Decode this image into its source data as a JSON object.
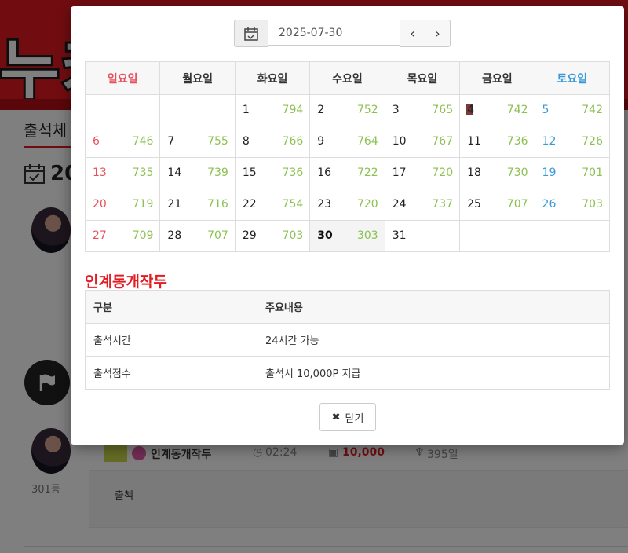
{
  "background": {
    "banner_text": "누키",
    "section_title": "출석체",
    "date_partial": "20",
    "rank": "301등",
    "row": {
      "name": "인계동개작두",
      "time": "02:24",
      "points": "10,000",
      "days": "395일"
    },
    "comment": "출첵"
  },
  "modal": {
    "date_value": "2025-07-30",
    "prev_label": "‹",
    "next_label": "›",
    "weekdays": [
      "일요일",
      "월요일",
      "화요일",
      "수요일",
      "목요일",
      "금요일",
      "토요일"
    ],
    "weeks": [
      [
        {
          "d": "",
          "c": ""
        },
        {
          "d": "",
          "c": ""
        },
        {
          "d": "1",
          "c": "794"
        },
        {
          "d": "2",
          "c": "752"
        },
        {
          "d": "3",
          "c": "765"
        },
        {
          "d": "4",
          "c": "742"
        },
        {
          "d": "5",
          "c": "742"
        }
      ],
      [
        {
          "d": "6",
          "c": "746"
        },
        {
          "d": "7",
          "c": "755"
        },
        {
          "d": "8",
          "c": "766"
        },
        {
          "d": "9",
          "c": "764"
        },
        {
          "d": "10",
          "c": "767"
        },
        {
          "d": "11",
          "c": "736"
        },
        {
          "d": "12",
          "c": "726"
        }
      ],
      [
        {
          "d": "13",
          "c": "735"
        },
        {
          "d": "14",
          "c": "739"
        },
        {
          "d": "15",
          "c": "736"
        },
        {
          "d": "16",
          "c": "722"
        },
        {
          "d": "17",
          "c": "720"
        },
        {
          "d": "18",
          "c": "730"
        },
        {
          "d": "19",
          "c": "701"
        }
      ],
      [
        {
          "d": "20",
          "c": "719"
        },
        {
          "d": "21",
          "c": "716"
        },
        {
          "d": "22",
          "c": "754"
        },
        {
          "d": "23",
          "c": "720"
        },
        {
          "d": "24",
          "c": "737"
        },
        {
          "d": "25",
          "c": "707"
        },
        {
          "d": "26",
          "c": "703"
        }
      ],
      [
        {
          "d": "27",
          "c": "709"
        },
        {
          "d": "28",
          "c": "707"
        },
        {
          "d": "29",
          "c": "703"
        },
        {
          "d": "30",
          "c": "303"
        },
        {
          "d": "31",
          "c": ""
        },
        {
          "d": "",
          "c": ""
        },
        {
          "d": "",
          "c": ""
        }
      ]
    ],
    "today": "30",
    "user_title": "인계동개작두",
    "info_headers": [
      "구분",
      "주요내용"
    ],
    "info_rows": [
      [
        "출석시간",
        "24시간 가능"
      ],
      [
        "출석점수",
        "출석시 10,000P 지급"
      ]
    ],
    "close_label": "닫기",
    "colors": {
      "sunday": "#e8505b",
      "saturday": "#3a9ad9",
      "count": "#8cc152",
      "accent": "#e31b23"
    }
  }
}
